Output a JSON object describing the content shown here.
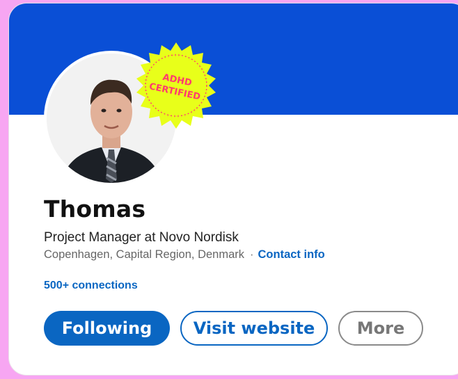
{
  "profile": {
    "name": "Thomas",
    "headline": "Project Manager at Novo Nordisk",
    "location": "Copenhagen, Capital Region, Denmark",
    "separator": "·",
    "contact_info": "Contact info",
    "connections": "500+ connections"
  },
  "sticker": {
    "line1": "ADHD",
    "line2": "CERTIFIED"
  },
  "actions": {
    "following_label": "Following",
    "visit_website_label": "Visit website",
    "more_label": "More"
  },
  "colors": {
    "banner": "#0a4fd6",
    "link": "#0a66c2",
    "sticker_fill": "#e8ff1a",
    "sticker_text": "#ff3c6e",
    "page_background": "#f7a6f2"
  }
}
